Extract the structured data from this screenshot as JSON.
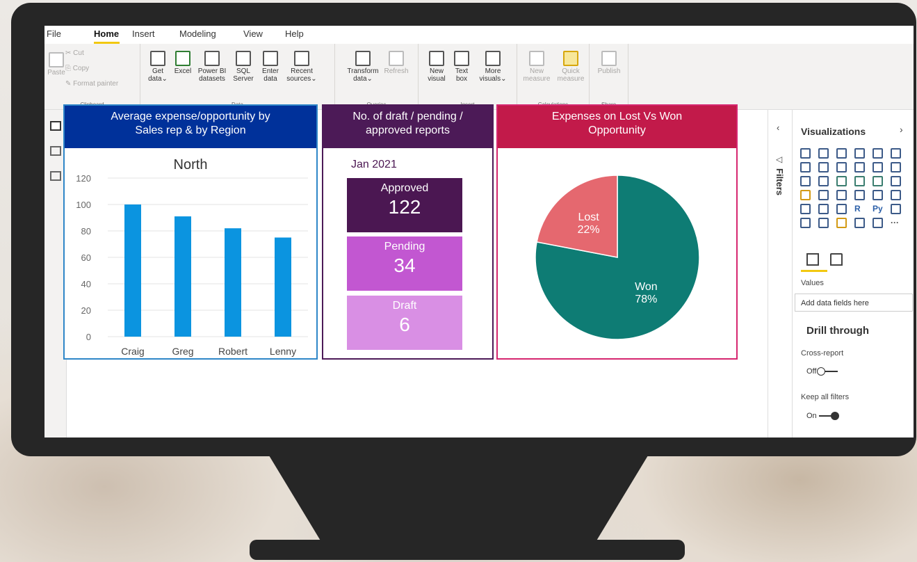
{
  "menu": {
    "file": "File",
    "home": "Home",
    "insert": "Insert",
    "modeling": "Modeling",
    "view": "View",
    "help": "Help"
  },
  "ribbon": {
    "clipboard": {
      "paste": "Paste",
      "cut": "Cut",
      "copy": "Copy",
      "format_painter": "Format painter",
      "group": "Clipboard"
    },
    "data": {
      "get_data": [
        "Get",
        "data⌄"
      ],
      "excel": "Excel",
      "pbi_datasets": [
        "Power BI",
        "datasets"
      ],
      "sql": [
        "SQL",
        "Server"
      ],
      "enter_data": [
        "Enter",
        "data"
      ],
      "recent": [
        "Recent",
        "sources⌄"
      ],
      "group": "Data"
    },
    "queries": {
      "transform": [
        "Transform",
        "data⌄"
      ],
      "refresh": "Refresh",
      "group": "Queries"
    },
    "insert": {
      "new_visual": [
        "New",
        "visual"
      ],
      "text_box": [
        "Text",
        "box"
      ],
      "more_visuals": [
        "More",
        "visuals⌄"
      ],
      "group": "Insert"
    },
    "calculations": {
      "new_measure": [
        "New",
        "measure"
      ],
      "quick_measure": [
        "Quick",
        "measure"
      ],
      "group": "Calculations"
    },
    "share": {
      "publish": "Publish",
      "group": "Share"
    }
  },
  "visual1": {
    "title_line1": "Average expense/opportunity by",
    "title_line2": "Sales rep & by Region",
    "header_color": "#00319a",
    "border_color": "#2e86c8"
  },
  "visual2": {
    "title_line1": "No. of draft / pending /",
    "title_line2": "approved reports",
    "period": "Jan 2021",
    "header_color": "#4c1a57",
    "cards": [
      {
        "label": "Approved",
        "value": "122",
        "color": "#4b1752"
      },
      {
        "label": "Pending",
        "value": "34",
        "color": "#c257d1"
      },
      {
        "label": "Draft",
        "value": "6",
        "color": "#d98fe4"
      }
    ]
  },
  "visual3": {
    "title_line1": "Expenses on Lost Vs Won",
    "title_line2": "Opportunity",
    "header_color": "#c21a4a",
    "border_color": "#d6266f"
  },
  "chart_data": [
    {
      "type": "bar",
      "title": "North",
      "categories": [
        "Craig",
        "Greg",
        "Robert",
        "Lenny"
      ],
      "values": [
        100,
        91,
        82,
        75
      ],
      "ylim": [
        0,
        120
      ],
      "yticks": [
        0,
        20,
        40,
        60,
        80,
        100,
        120
      ],
      "grid": true,
      "bar_color": "#0b94e0"
    },
    {
      "type": "pie",
      "labels": [
        "Won",
        "Lost"
      ],
      "values": [
        78,
        22
      ],
      "value_labels": [
        "78%",
        "22%"
      ],
      "colors": [
        "#0e7c74",
        "#e5686f"
      ]
    }
  ],
  "filters_label": "Filters",
  "viz_pane": {
    "title": "Visualizations",
    "values_label": "Values",
    "add_fields": "Add data fields here",
    "drill_through": "Drill through",
    "cross_report": "Cross-report",
    "cross_state": "Off",
    "keep_filters": "Keep all filters",
    "keep_state": "On",
    "r_label": "R",
    "py_label": "Py",
    "more": "···"
  }
}
